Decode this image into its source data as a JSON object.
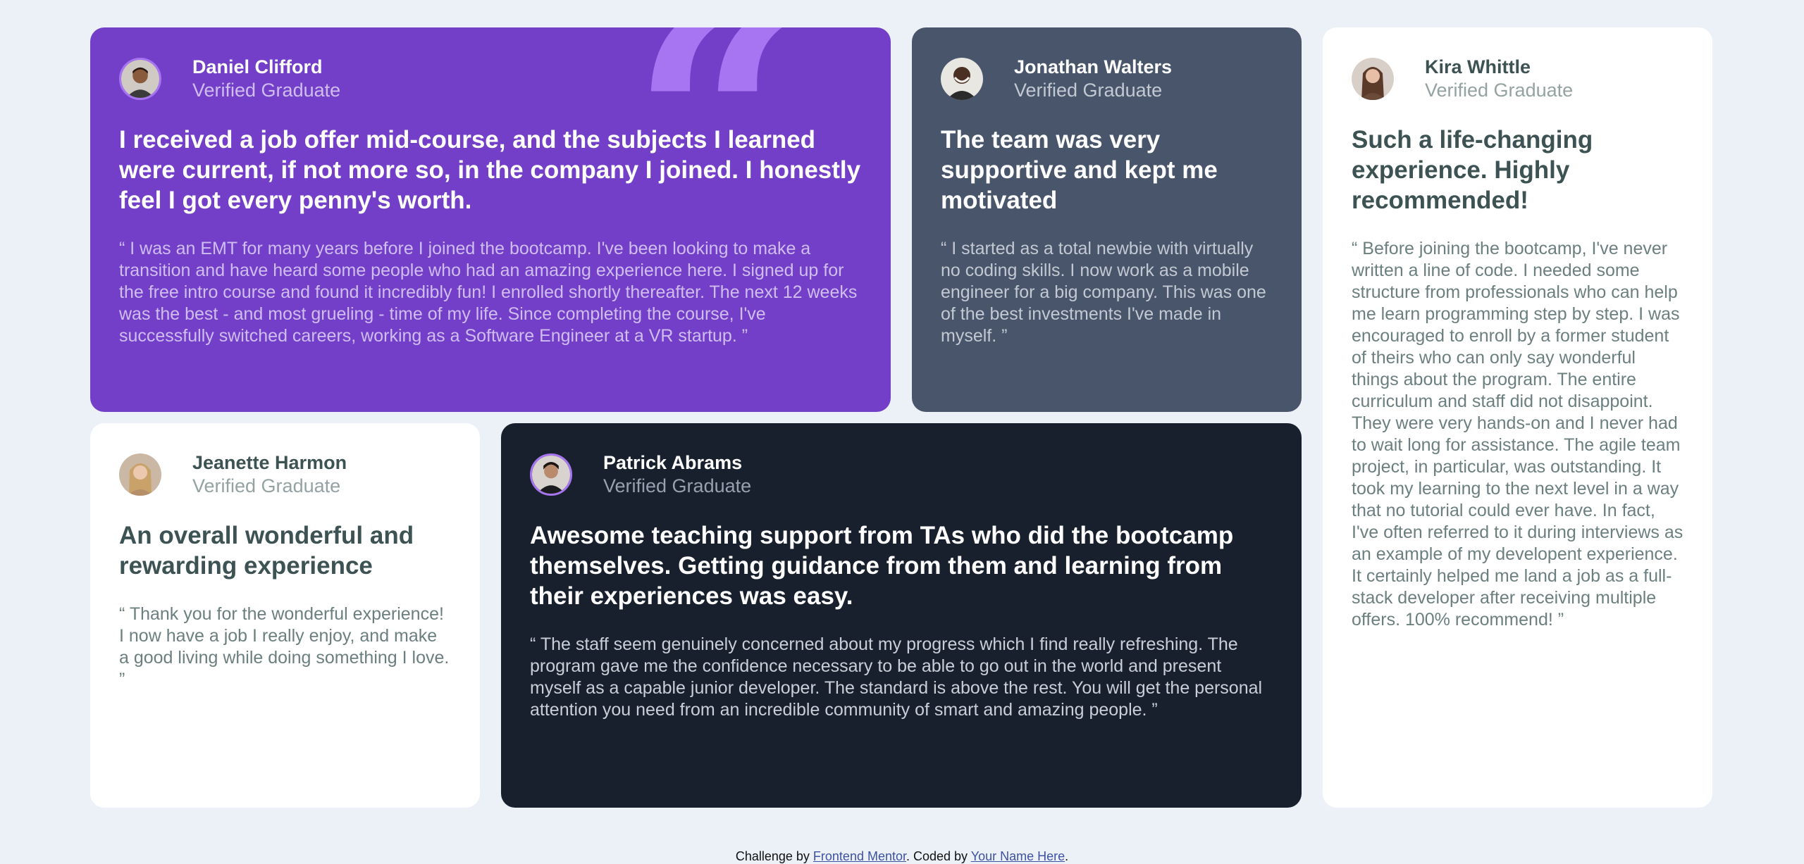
{
  "colors": {
    "background": "#ecf1f8",
    "moderate_violet": "#733fc8",
    "grayish_blue": "#48556a",
    "very_dark_blue": "#19202d",
    "white": "#ffffff",
    "quote_mark": "#a775f1"
  },
  "testimonials": [
    {
      "name": "Daniel Clifford",
      "role": "Verified Graduate",
      "title": "I received a job offer mid-course, and the subjects I learned were current, if not more so, in the company I joined. I honestly feel I got every penny's worth.",
      "body": "“ I was an EMT for many years before I joined the bootcamp. I've been looking to make a transition and have heard some people who had an amazing experience here. I signed up for the free intro course and found it incredibly fun! I enrolled shortly thereafter. The next 12 weeks was the best - and most grueling - time of my life. Since completing the course, I've successfully switched careers, working as a Software Engineer at a VR startup. ”"
    },
    {
      "name": "Jonathan Walters",
      "role": "Verified Graduate",
      "title": "The team was very supportive and kept me motivated",
      "body": "“ I started as a total newbie with virtually no coding skills. I now work as a mobile engineer for a big company. This was one of the best investments I've made in myself. ”"
    },
    {
      "name": "Kira Whittle",
      "role": "Verified Graduate",
      "title": "Such a life-changing experience. Highly recommended!",
      "body": "“ Before joining the bootcamp, I've never written a line of code. I needed some structure from professionals who can help me learn programming step by step. I was encouraged to enroll by a former student of theirs who can only say wonderful things about the program. The entire curriculum and staff did not disappoint. They were very hands-on and I never had to wait long for assistance. The agile team project, in particular, was outstanding. It took my learning to the next level in a way that no tutorial could ever have. In fact, I've often referred to it during interviews as an example of my developent experience. It certainly helped me land a job as a full-stack developer after receiving multiple offers. 100% recommend! ”"
    },
    {
      "name": "Jeanette Harmon",
      "role": "Verified Graduate",
      "title": "An overall wonderful and rewarding experience",
      "body": "“ Thank you for the wonderful experience! I now have a job I really enjoy, and make a good living while doing something I love. ”"
    },
    {
      "name": "Patrick Abrams",
      "role": "Verified Graduate",
      "title": "Awesome teaching support from TAs who did the bootcamp themselves. Getting guidance from them and learning from their experiences was easy.",
      "body": "“ The staff seem genuinely concerned about my progress which I find really refreshing. The program gave me the confidence necessary to be able to go out in the world and present myself as a capable junior developer. The standard is above the rest. You will get the personal attention you need from an incredible community of smart and amazing people. ”"
    }
  ],
  "decoration": {
    "quote_icon": "large-quotation-mark-icon",
    "quote_glyph": "“"
  },
  "footer": {
    "prefix": "Challenge by ",
    "link1": "Frontend Mentor",
    "middle": ". Coded by ",
    "link2": "Your Name Here",
    "suffix": "."
  }
}
